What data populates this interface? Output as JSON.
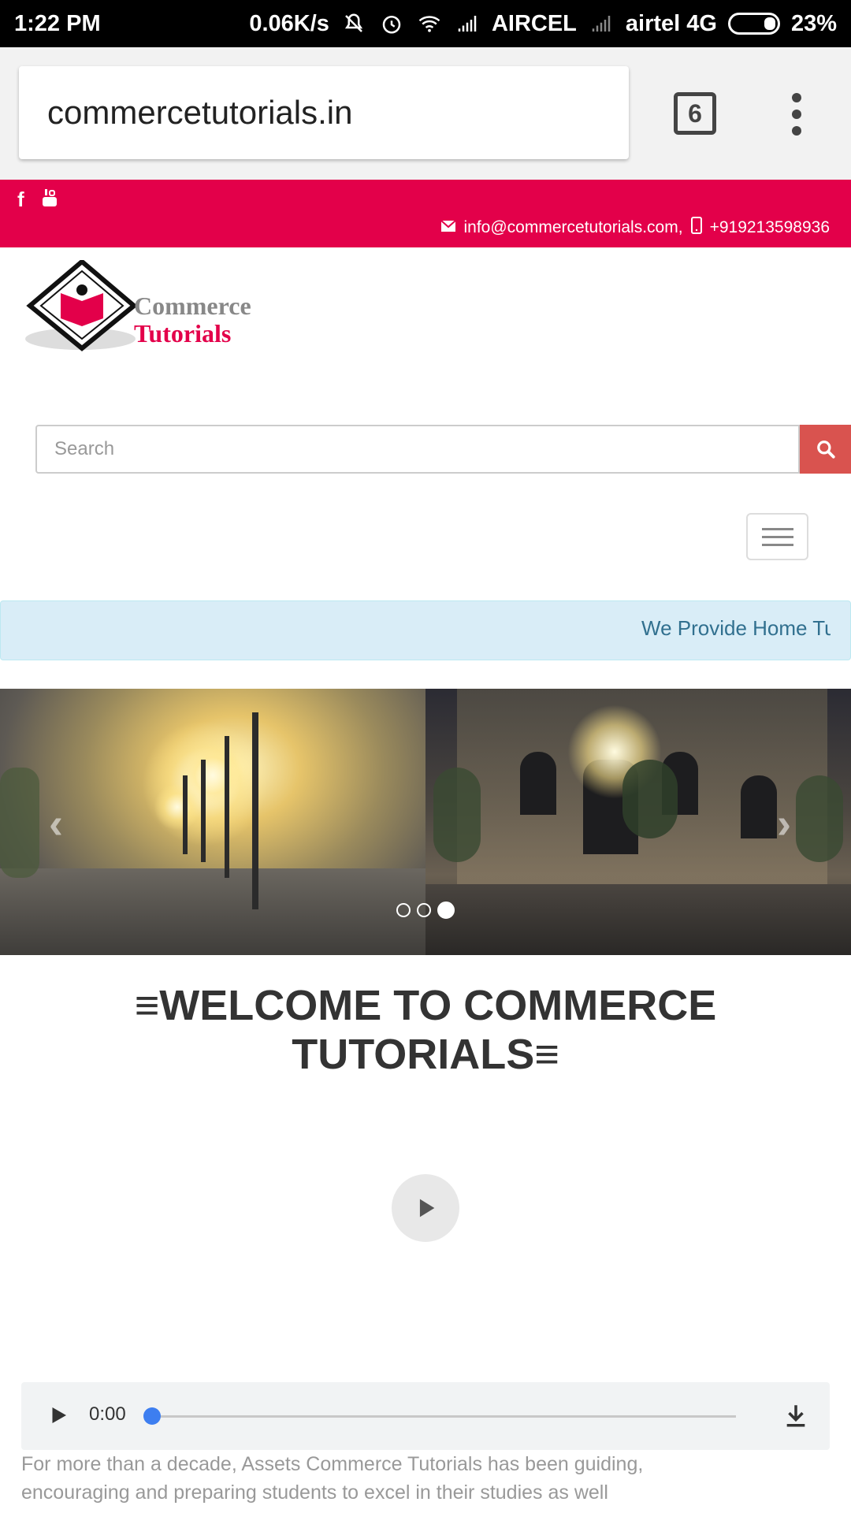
{
  "status_bar": {
    "time": "1:22 PM",
    "speed": "0.06K/s",
    "carrier1": "AIRCEL",
    "carrier2": "airtel 4G",
    "battery": "23%"
  },
  "browser": {
    "url": "commercetutorials.in",
    "tab_count": "6"
  },
  "topbar": {
    "social": [
      "facebook-icon",
      "youtube-icon"
    ],
    "email": "info@commercetutorials.com,",
    "phone": "+919213598936",
    "color": "#e3004a"
  },
  "logo": {
    "line1": "Commerce",
    "line2": "Tutorials"
  },
  "search": {
    "placeholder": "Search",
    "button_color": "#d9534f"
  },
  "marquee": {
    "text": "We Provide Home Tut"
  },
  "carousel": {
    "slide_count": 3,
    "active_index": 2
  },
  "welcome": {
    "title": "≡WELCOME TO COMMERCE TUTORIALS≡"
  },
  "audio": {
    "time": "0:00",
    "progress": 0
  },
  "intro": {
    "line1": "For more than a decade, Assets Commerce Tutorials has been guiding,",
    "line2": "encouraging and preparing students to excel in their studies as well"
  }
}
